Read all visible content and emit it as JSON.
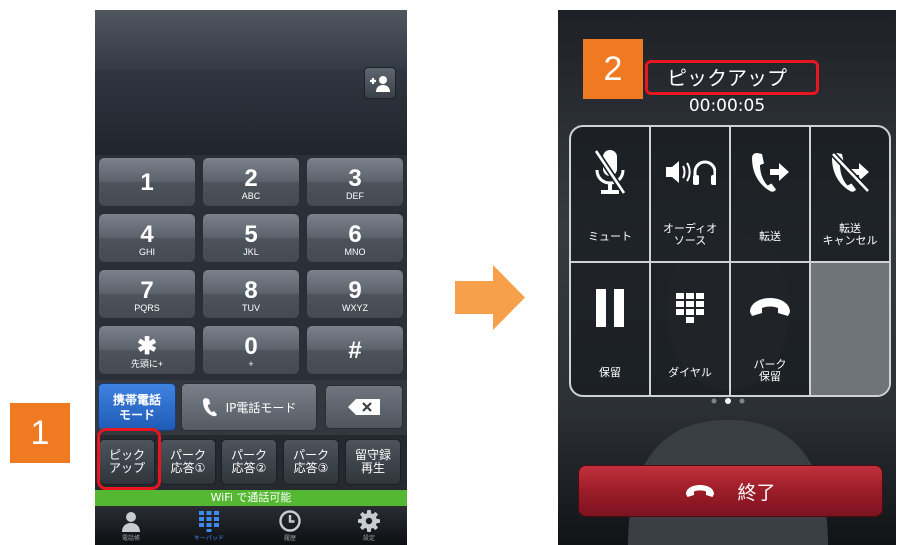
{
  "left_screen": {
    "keys": [
      {
        "num": "1",
        "letters": ""
      },
      {
        "num": "2",
        "letters": "ABC"
      },
      {
        "num": "3",
        "letters": "DEF"
      },
      {
        "num": "4",
        "letters": "GHI"
      },
      {
        "num": "5",
        "letters": "JKL"
      },
      {
        "num": "6",
        "letters": "MNO"
      },
      {
        "num": "7",
        "letters": "PQRS"
      },
      {
        "num": "8",
        "letters": "TUV"
      },
      {
        "num": "9",
        "letters": "WXYZ"
      },
      {
        "num": "✱",
        "letters": "先頭に+"
      },
      {
        "num": "0",
        "letters": "+"
      },
      {
        "num": "#",
        "letters": ""
      }
    ],
    "mode_mobile": "携帯電話\nモード",
    "mode_ip": "IP電話モード",
    "function_keys": [
      "ピック\nアップ",
      "パーク\n応答①",
      "パーク\n応答②",
      "パーク\n応答③",
      "留守録\n再生"
    ],
    "wifi_status": "WiFi で通話可能",
    "tabs": [
      "電話帳",
      "キーパッド",
      "履歴",
      "設定"
    ],
    "active_tab": "キーパッド"
  },
  "right_screen": {
    "call_name": "ピックアップ",
    "call_timer": "00:00:05",
    "controls": [
      {
        "label": "ミュート",
        "icon": "mic-muted-icon"
      },
      {
        "label": "オーディオ\nソース",
        "icon": "audio-source-icon"
      },
      {
        "label": "転送",
        "icon": "transfer-icon"
      },
      {
        "label": "転送\nキャンセル",
        "icon": "transfer-cancel-icon"
      },
      {
        "label": "保留",
        "icon": "pause-icon"
      },
      {
        "label": "ダイヤル",
        "icon": "dialpad-icon"
      },
      {
        "label": "パーク\n保留",
        "icon": "park-hold-icon"
      },
      {
        "label": "",
        "icon": ""
      }
    ],
    "page_dots": 3,
    "active_dot": 1,
    "end_label": "終了"
  },
  "steps": [
    "1",
    "2"
  ],
  "colors": {
    "highlight": "#e8161e",
    "step_badge": "#f07a22",
    "arrow": "#f7a04b",
    "wifi_green": "#55b833",
    "mobile_mode_blue": "#2f6fd0",
    "end_red": "#9b1d28"
  }
}
